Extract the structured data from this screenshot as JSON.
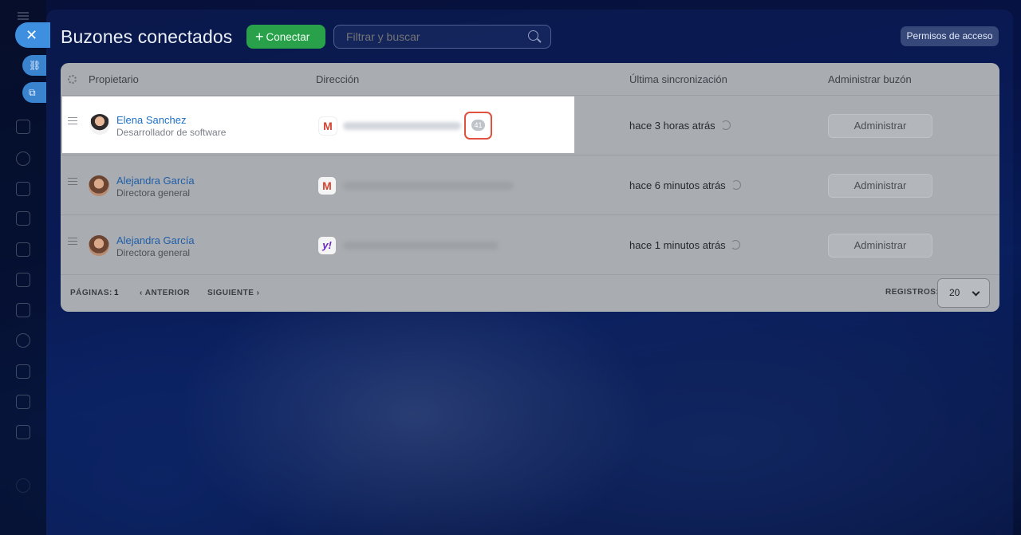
{
  "header": {
    "title": "Buzones conectados",
    "connect_label": "Conectar",
    "search_placeholder": "Filtrar y buscar",
    "access_label": "Permisos de acceso"
  },
  "table": {
    "columns": [
      "Propietario",
      "Dirección",
      "Última sincronización",
      "Administrar buzón"
    ],
    "rows": [
      {
        "name": "Elena Sanchez",
        "role": "Desarrollador de software",
        "provider": "gmail",
        "unread": "41",
        "sync": "hace 3 horas atrás",
        "action": "Administrar"
      },
      {
        "name": "Alejandra García",
        "role": "Directora general",
        "provider": "gmail",
        "sync": "hace 6 minutos atrás",
        "action": "Administrar"
      },
      {
        "name": "Alejandra García",
        "role": "Directora general",
        "provider": "yahoo",
        "sync": "hace 1 minutos atrás",
        "action": "Administrar"
      }
    ]
  },
  "pagination": {
    "pages_label": "PÁGINAS:",
    "current_page": "1",
    "prev_label": "ANTERIOR",
    "next_label": "SIGUIENTE",
    "records_label": "REGISTROS:",
    "records_value": "20"
  },
  "icons": {
    "close": "close-icon",
    "connect": "plus-icon",
    "search": "search-icon",
    "settings": "gear-icon",
    "drag": "drag-handle-icon",
    "sync": "refresh-icon",
    "gmail": "gmail-icon",
    "yahoo": "yahoo-icon"
  },
  "colors": {
    "connect_button": "#29a14b",
    "highlight_border": "#e0513e",
    "link": "#1e6fc5"
  }
}
